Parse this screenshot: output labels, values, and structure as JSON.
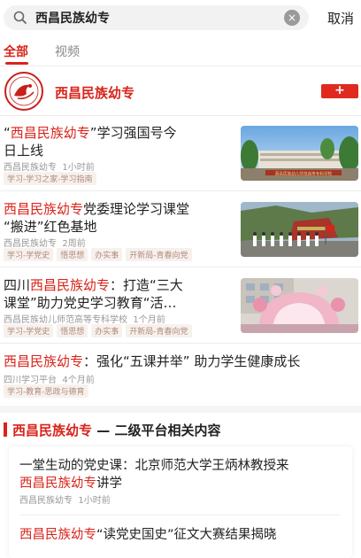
{
  "search": {
    "query": "西昌民族幼专",
    "cancel_label": "取消"
  },
  "tabs": [
    {
      "label": "全部",
      "active": true
    },
    {
      "label": "视频",
      "active": false
    }
  ],
  "account": {
    "name": "西昌民族幼专",
    "follow_label": "+"
  },
  "articles": [
    {
      "title_parts": [
        "“",
        "西昌民族幼专",
        "”学习强国号今",
        "日上线"
      ],
      "source": "西昌民族幼专",
      "time": "1小时前",
      "tags": [
        "学习-学习之家-学习指南"
      ],
      "thumb_caption": "西昌民族幼儿师范高等专科学校"
    },
    {
      "title_parts": [
        "西昌民族幼专",
        "党委理论学习课堂",
        "“搬进”红色基地"
      ],
      "source": "西昌民族幼专",
      "time": "2周前",
      "tags": [
        "学习-学党史",
        "悟思想",
        "办实事",
        "开新局-青春向党"
      ]
    },
    {
      "title_parts": [
        "四川",
        "西昌民族幼专",
        "：打造“三大",
        "课堂”助力党史学习教育“活…"
      ],
      "source": "西昌民族幼儿师范高等专科学校",
      "time": "1个月前",
      "tags": [
        "学习-学党史",
        "悟思想",
        "办实事",
        "开新局-青春向党"
      ]
    },
    {
      "title_parts": [
        "西昌民族幼专",
        "：强化“五课并举” 助力学生健康成长"
      ],
      "source": "四川学习平台",
      "time": "4个月前",
      "tags": [
        "学习-教育-思政与德育"
      ]
    }
  ],
  "section": {
    "title_hl": "西昌民族幼专",
    "title_rest": " — 二级平台相关内容"
  },
  "related": [
    {
      "line1": "一堂生动的党史课：北京师范大学王炳林教授来",
      "line2_hl": "西昌民族幼专",
      "line2_rest": "讲学",
      "source": "西昌民族幼专",
      "time": "1小时前"
    },
    {
      "line1_hl": "西昌民族幼专",
      "line1_rest": "“读党史国史”征文大赛结果揭晓"
    }
  ],
  "colors": {
    "accent": "#d9241b"
  }
}
